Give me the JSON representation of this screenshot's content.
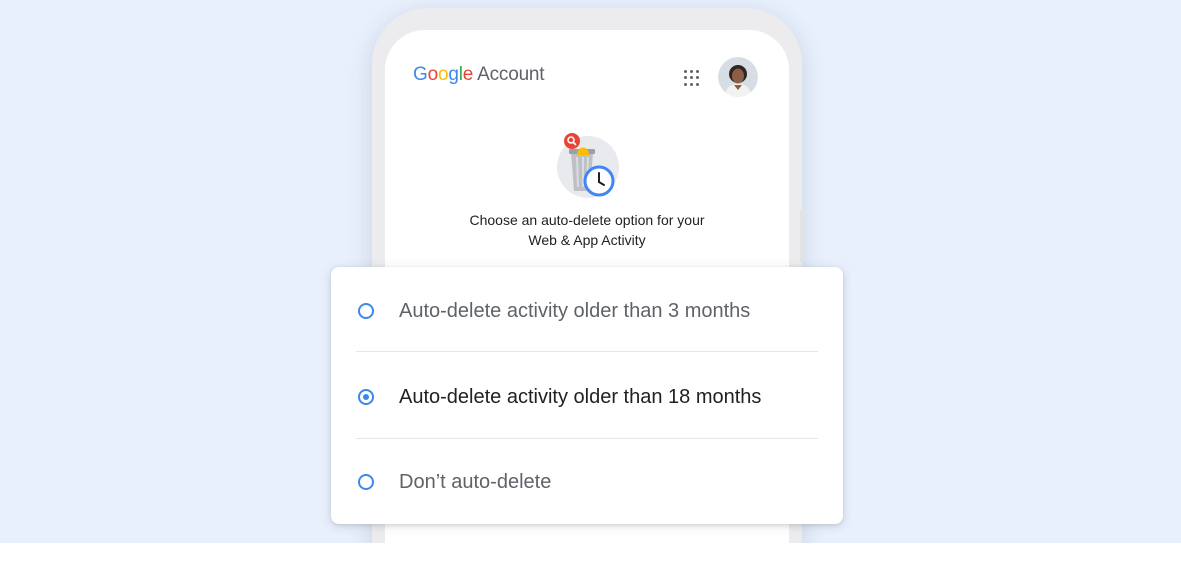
{
  "header": {
    "logo_letters": [
      "G",
      "o",
      "o",
      "g",
      "l",
      "e"
    ],
    "logo_suffix": "Account",
    "apps_icon": "apps-grid-icon",
    "avatar": "user-avatar"
  },
  "illustration": "auto-delete-clock-icon",
  "prompt": {
    "line1": "Choose an auto-delete option for your",
    "line2": "Web & App Activity"
  },
  "options": [
    {
      "label": "Auto-delete activity older than 3 months",
      "selected": false
    },
    {
      "label": "Auto-delete activity older than 18 months",
      "selected": true
    },
    {
      "label": "Don’t auto-delete",
      "selected": false
    }
  ],
  "colors": {
    "background": "#e8f0fd",
    "accent": "#1a73e8",
    "google_blue": "#4285f4",
    "google_red": "#ea4335",
    "google_yellow": "#fbbc05",
    "google_green": "#34a853"
  }
}
